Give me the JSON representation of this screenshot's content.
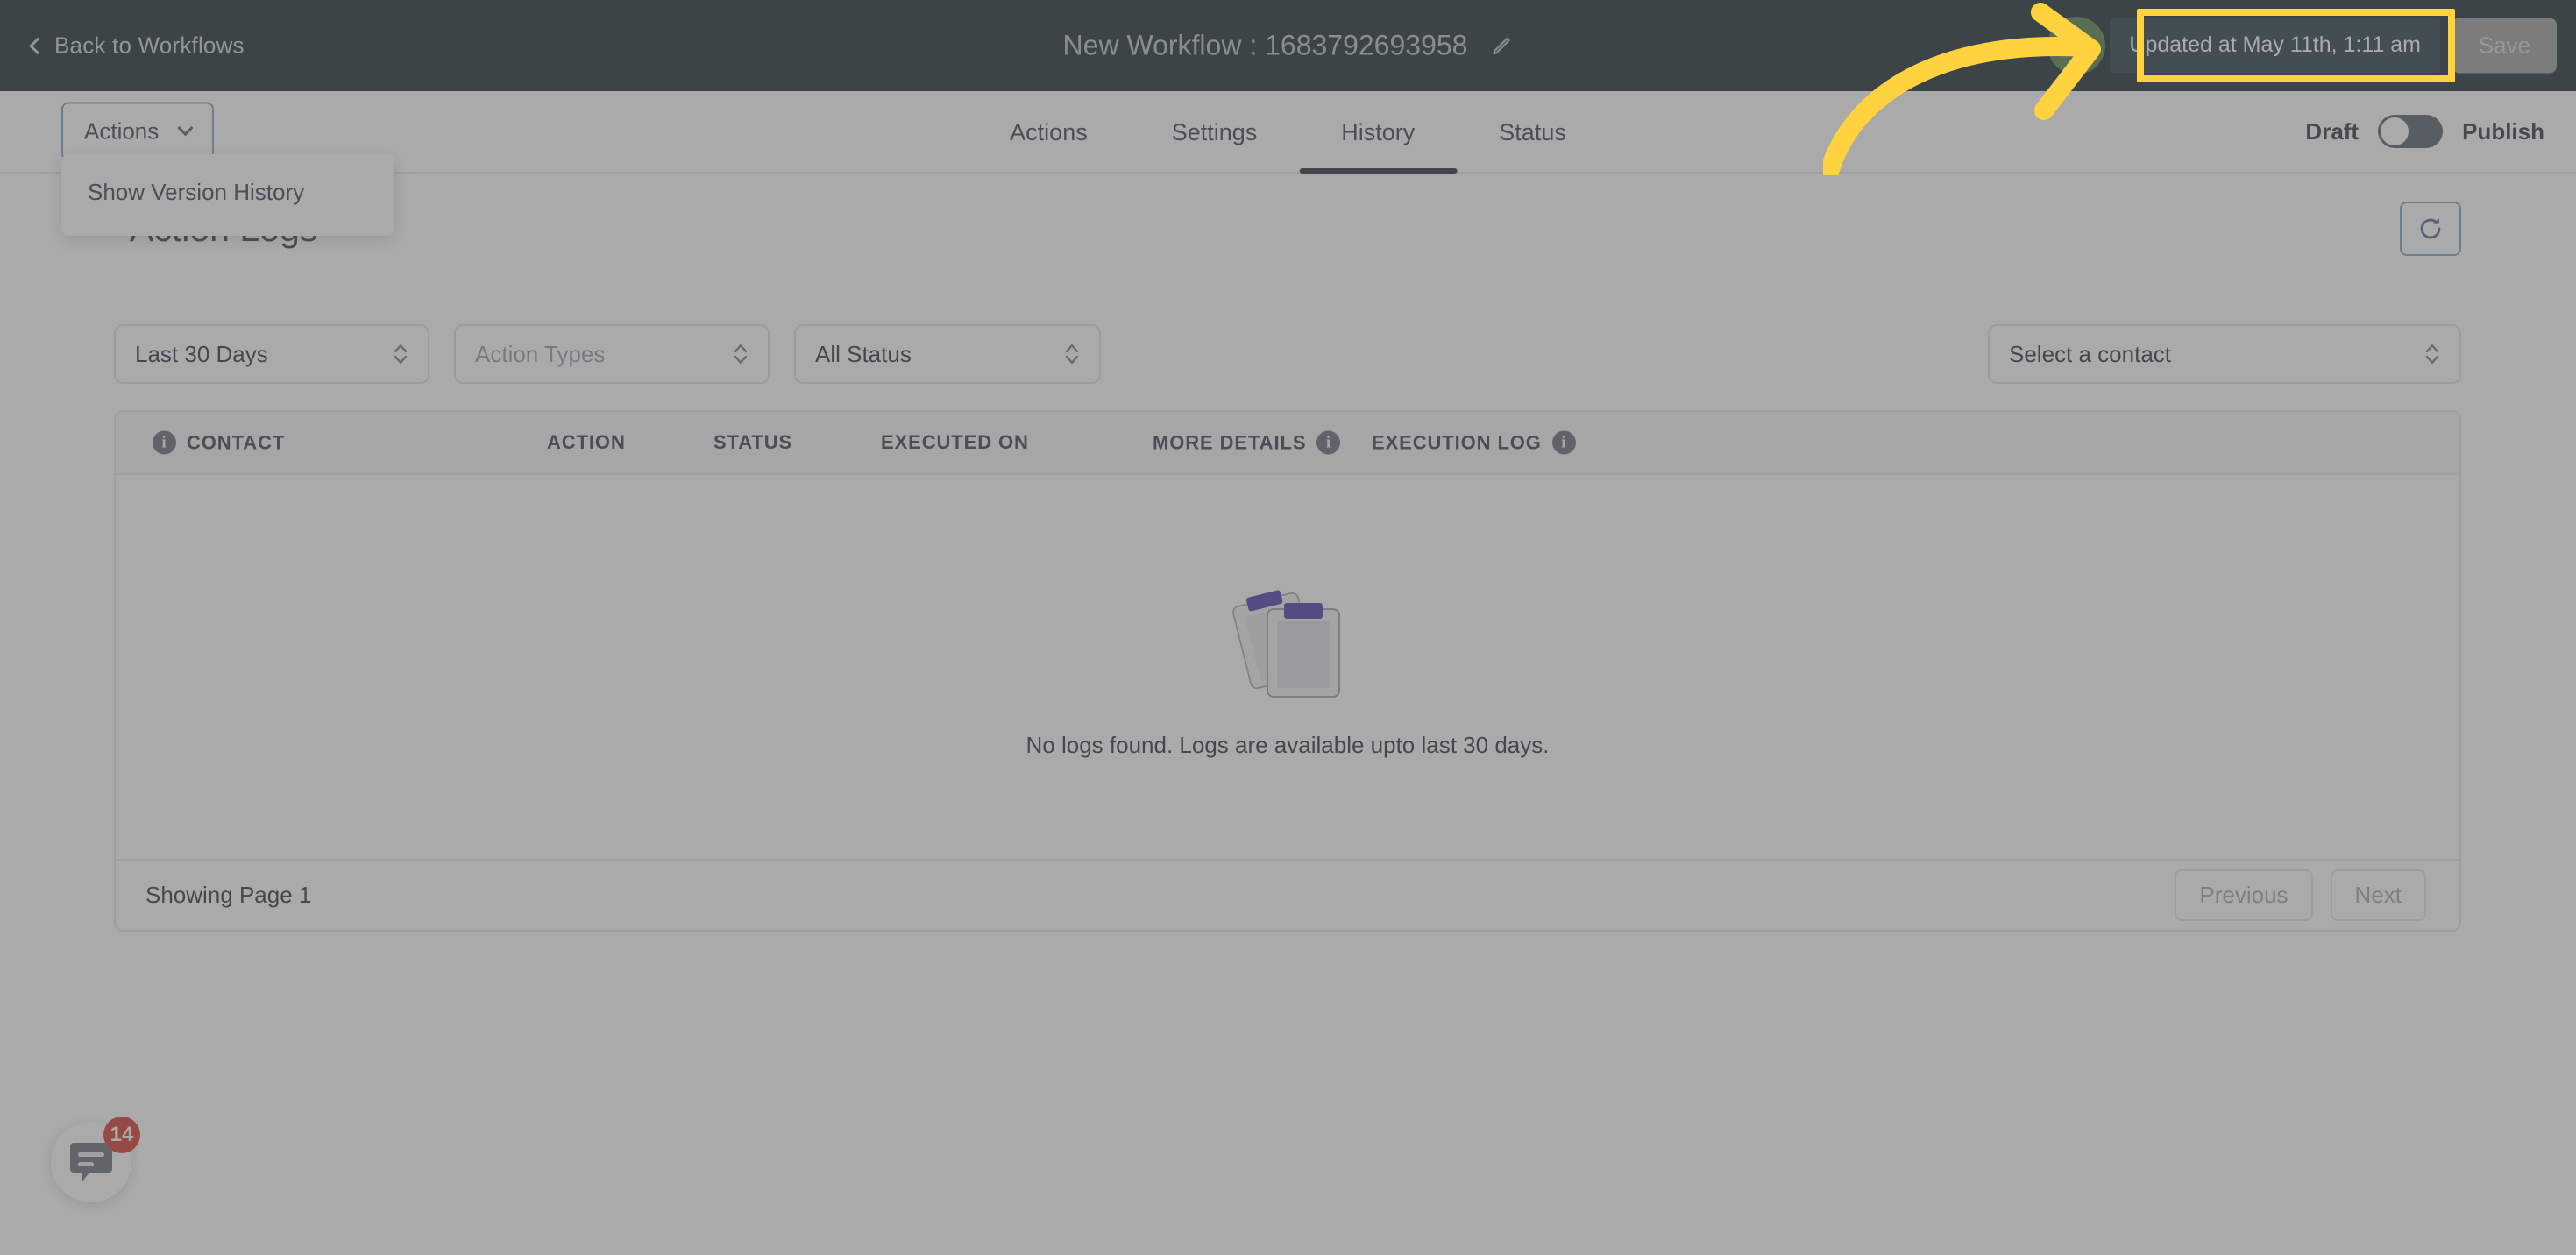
{
  "topbar": {
    "back_label": "Back to Workflows",
    "back_icon": "chevron-left-icon",
    "workflow_title": "New Workflow : 1683792693958",
    "edit_icon": "pencil-icon",
    "updated_text": "Updated at May 11th, 1:11 am",
    "save_label": "Save",
    "background_color": "#0f1d26",
    "avatar_color": "#4d7a3e"
  },
  "navbar": {
    "actions_button": {
      "label": "Actions",
      "icon": "chevron-down-icon"
    },
    "dropdown": {
      "items": [
        {
          "label": "Show Version History"
        }
      ]
    },
    "tabs": [
      {
        "label": "Actions",
        "active": false
      },
      {
        "label": "Settings",
        "active": false
      },
      {
        "label": "History",
        "active": true
      },
      {
        "label": "Status",
        "active": false
      }
    ],
    "toggle": {
      "left_label": "Draft",
      "right_label": "Publish",
      "state": "Draft"
    }
  },
  "main": {
    "title": "Action Logs",
    "refresh_icon": "refresh-icon",
    "filters": {
      "date_range": {
        "value": "Last 30 Days",
        "is_placeholder": false
      },
      "action_types": {
        "value": "Action Types",
        "is_placeholder": true
      },
      "status": {
        "value": "All Status",
        "is_placeholder": false
      },
      "contact": {
        "value": "Select a contact",
        "is_placeholder": false
      }
    },
    "table": {
      "columns": [
        {
          "label": "CONTACT",
          "info": true
        },
        {
          "label": "ACTION",
          "info": false
        },
        {
          "label": "STATUS",
          "info": false
        },
        {
          "label": "EXECUTED ON",
          "info": false
        },
        {
          "label": "MORE DETAILS",
          "info": true
        },
        {
          "label": "EXECUTION LOG",
          "info": true
        }
      ],
      "rows": [],
      "empty_message": "No logs found. Logs are available upto last 30 days.",
      "empty_illustration": "clipboards-icon"
    },
    "footer": {
      "showing_page": "Showing Page 1",
      "previous_label": "Previous",
      "next_label": "Next"
    }
  },
  "chat_widget": {
    "icon": "chat-bubble-icon",
    "badge_count": "14",
    "badge_color": "#d3281f"
  },
  "annotation": {
    "arrow_icon": "curved-arrow-right-icon",
    "arrow_color": "#ffd23f",
    "highlight_color": "#ffd23f"
  }
}
